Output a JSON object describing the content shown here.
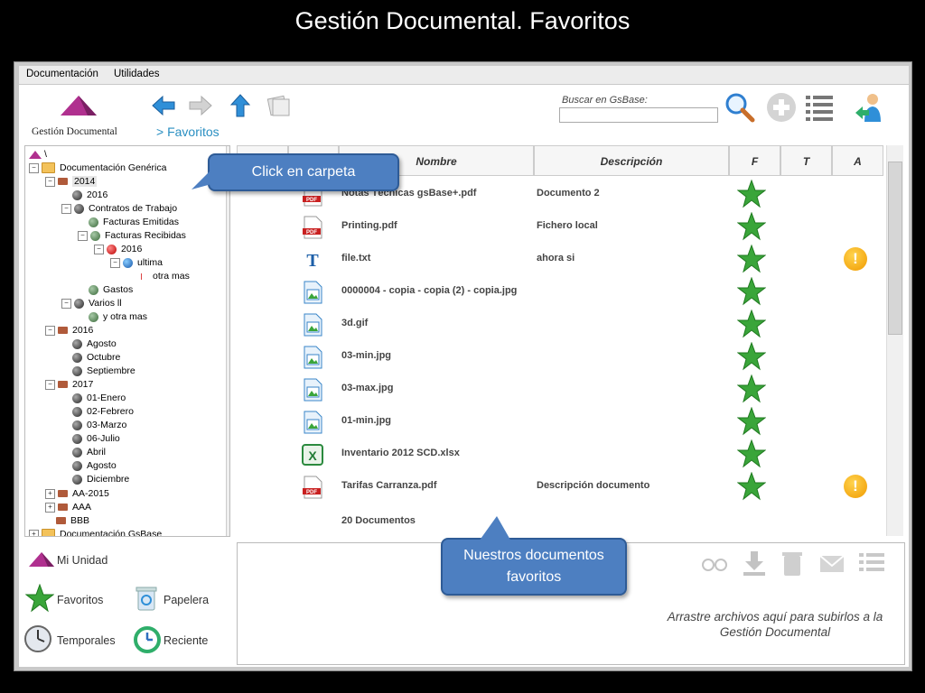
{
  "slide_title": "Gestión Documental. Favoritos",
  "menu": [
    "Documentación",
    "Utilidades"
  ],
  "toolbar": {
    "logo_label": "Gestión Documental",
    "breadcrumb": "> Favoritos",
    "search_label": "Buscar en GsBase:",
    "search_value": ""
  },
  "tree": {
    "root": "\\",
    "nodes": [
      {
        "label": "Documentación Genérica"
      },
      {
        "label": "2014"
      },
      {
        "label": "2016"
      },
      {
        "label": "Contratos de Trabajo"
      },
      {
        "label": "Facturas Emitidas"
      },
      {
        "label": "Facturas Recibidas"
      },
      {
        "label": "2016"
      },
      {
        "label": "ultima"
      },
      {
        "label": "otra mas"
      },
      {
        "label": "Gastos"
      },
      {
        "label": "Varios ll"
      },
      {
        "label": "y otra mas"
      },
      {
        "label": "2016"
      },
      {
        "label": "Agosto"
      },
      {
        "label": "Octubre"
      },
      {
        "label": "Septiembre"
      },
      {
        "label": "2017"
      },
      {
        "label": "01-Enero"
      },
      {
        "label": "02-Febrero"
      },
      {
        "label": "03-Marzo"
      },
      {
        "label": "06-Julio"
      },
      {
        "label": "Abril"
      },
      {
        "label": "Agosto"
      },
      {
        "label": "Diciembre"
      },
      {
        "label": "AA-2015"
      },
      {
        "label": "AAA"
      },
      {
        "label": "BBB"
      },
      {
        "label": "Documentación GsBase"
      }
    ]
  },
  "quick_links": {
    "mi_unidad": "Mi Unidad",
    "favoritos": "Favoritos",
    "papelera": "Papelera",
    "temporales": "Temporales",
    "reciente": "Reciente"
  },
  "grid": {
    "columns": {
      "nombre": "Nombre",
      "descripcion": "Descripción",
      "f": "F",
      "t": "T",
      "a": "A"
    },
    "rows": [
      {
        "name": "Notas Técnicas gsBase+.pdf",
        "desc": "Documento 2",
        "type": "pdf",
        "fav": true,
        "alert": false
      },
      {
        "name": "Printing.pdf",
        "desc": "Fichero local",
        "type": "pdf",
        "fav": true,
        "alert": false
      },
      {
        "name": "file.txt",
        "desc": "ahora si",
        "type": "txt",
        "fav": true,
        "alert": true
      },
      {
        "name": "0000004 - copia - copia (2) - copia.jpg",
        "desc": "",
        "type": "img",
        "fav": true,
        "alert": false
      },
      {
        "name": "3d.gif",
        "desc": "",
        "type": "img",
        "fav": true,
        "alert": false
      },
      {
        "name": "03-min.jpg",
        "desc": "",
        "type": "img",
        "fav": true,
        "alert": false
      },
      {
        "name": "03-max.jpg",
        "desc": "",
        "type": "img",
        "fav": true,
        "alert": false
      },
      {
        "name": "01-min.jpg",
        "desc": "",
        "type": "img",
        "fav": true,
        "alert": false
      },
      {
        "name": "Inventario 2012 SCD.xlsx",
        "desc": "",
        "type": "xls",
        "fav": true,
        "alert": false
      },
      {
        "name": "Tarifas Carranza.pdf",
        "desc": "Descripción documento",
        "type": "pdf",
        "fav": true,
        "alert": true
      }
    ],
    "footer": "20 Documentos"
  },
  "dropzone_text": "Arrastre archivos aquí para subirlos a la Gestión Documental",
  "callouts": {
    "carpeta": "Click en carpeta",
    "favoritos": "Nuestros documentos favoritos"
  },
  "colors": {
    "accent": "#2a8fc2",
    "callout": "#4d7fc1",
    "star": "#3aa53a",
    "alert": "#f09a00"
  }
}
